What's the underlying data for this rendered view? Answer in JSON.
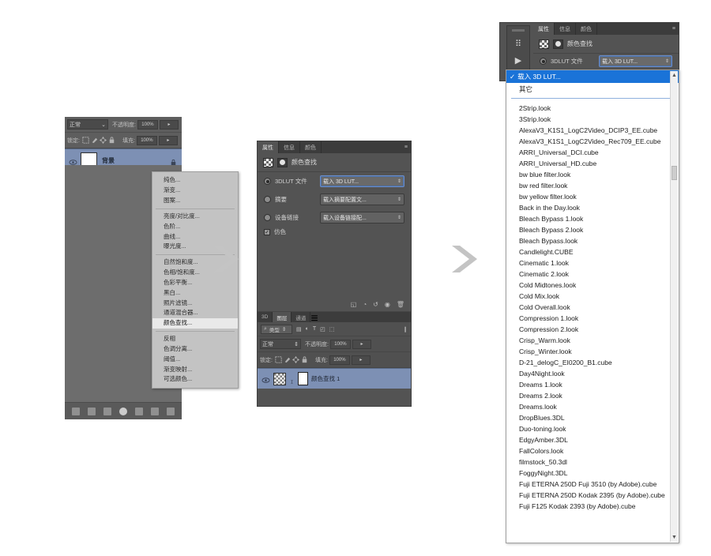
{
  "app": "Adobe Photoshop",
  "steps": {
    "step1": {
      "name": "layers-panel-with-adjustment-menu",
      "blend_mode": "正常",
      "opacity_label": "不透明度:",
      "opacity_value": "100%",
      "lock_label": "锁定:",
      "fill_label": "填充:",
      "fill_value": "100%",
      "layer": {
        "name": "背景",
        "lock_icon": "lock-icon",
        "eye_icon": "eye-icon"
      },
      "bottom_icons": [
        "link-icon",
        "fx-icon",
        "mask-icon",
        "adjustment-icon",
        "group-icon",
        "new-layer-icon",
        "delete-icon"
      ],
      "menu": {
        "groups": [
          [
            "纯色...",
            "渐变...",
            "图案..."
          ],
          [
            "亮度/对比度...",
            "色阶...",
            "曲线...",
            "曝光度..."
          ],
          [
            "自然饱和度...",
            "色相/饱和度...",
            "色彩平衡...",
            "黑白...",
            "照片滤镜...",
            "通道混合器..."
          ],
          [
            "颜色查找..."
          ],
          [
            "反相",
            "色调分离...",
            "阈值...",
            "渐变映射...",
            "可选颜色..."
          ]
        ],
        "selected": "颜色查找..."
      }
    },
    "step2": {
      "name": "color-lookup-properties-panel",
      "tabs": [
        {
          "label": "属性",
          "active": true
        },
        {
          "label": "信息",
          "active": false
        },
        {
          "label": "颜色",
          "active": false
        }
      ],
      "panel_menu_icon": "panel-menu-icon",
      "title": "颜色查找",
      "options": [
        {
          "label": "3DLUT 文件",
          "selected": true,
          "value": "载入 3D LUT...",
          "focused": true
        },
        {
          "label": "摘要",
          "selected": false,
          "value": "载入摘要配置文...",
          "focused": false
        },
        {
          "label": "设备链接",
          "selected": false,
          "value": "载入设备链接配...",
          "focused": false
        }
      ],
      "checkbox": {
        "label": "仿色",
        "checked": true
      },
      "toolbar_icons": [
        "clip-to-layer-icon",
        "view-previous-icon",
        "reset-icon",
        "eye-icon",
        "delete-icon"
      ],
      "layers": {
        "tabs": [
          {
            "label": "3D",
            "active": false
          },
          {
            "label": "图层",
            "active": true
          },
          {
            "label": "通道",
            "active": false
          }
        ],
        "filter_label": "类型",
        "filter_icons": [
          "search-icon",
          "pixel-icon",
          "adjustment-icon",
          "type-icon",
          "shape-icon",
          "smart-icon",
          "lock-filter-icon"
        ],
        "blend_mode": "正常",
        "opacity_label": "不透明度:",
        "opacity_value": "100%",
        "lock_label": "锁定:",
        "fill_label": "填充:",
        "fill_value": "100%",
        "layer_row": {
          "eye_icon": "eye-icon",
          "name": "颜色查找 1"
        }
      }
    },
    "step3": {
      "name": "lut-dropdown-list",
      "tabs": [
        {
          "label": "属性",
          "active": true
        },
        {
          "label": "信息",
          "active": false
        },
        {
          "label": "颜色",
          "active": false
        }
      ],
      "panel_menu_icon": "panel-menu-icon",
      "title": "颜色查找",
      "option_label": "3DLUT 文件",
      "option_value": "载入 3D LUT...",
      "dropdown": {
        "checked_item": "载入 3D LUT...",
        "second_item": "其它",
        "check_icon": "check-icon",
        "files": [
          "2Strip.look",
          "3Strip.look",
          "AlexaV3_K1S1_LogC2Video_DCIP3_EE.cube",
          "AlexaV3_K1S1_LogC2Video_Rec709_EE.cube",
          "ARRI_Universal_DCI.cube",
          "ARRI_Universal_HD.cube",
          "bw blue filter.look",
          "bw red filter.look",
          "bw yellow filter.look",
          "Back in the Day.look",
          "Bleach Bypass 1.look",
          "Bleach Bypass 2.look",
          "Bleach Bypass.look",
          "Candlelight.CUBE",
          "Cinematic 1.look",
          "Cinematic 2.look",
          "Cold Midtones.look",
          "Cold Mix.look",
          "Cold Overall.look",
          "Compression 1.look",
          "Compression 2.look",
          "Crisp_Warm.look",
          "Crisp_Winter.look",
          "D-21_delogC_EI0200_B1.cube",
          "Day4Night.look",
          "Dreams 1.look",
          "Dreams 2.look",
          "Dreams.look",
          "DropBlues.3DL",
          "Duo-toning.look",
          "EdgyAmber.3DL",
          "FallColors.look",
          "filmstock_50.3dl",
          "FoggyNight.3DL",
          "Fuji ETERNA 250D Fuji 3510 (by Adobe).cube",
          "Fuji ETERNA 250D Kodak 2395 (by Adobe).cube",
          "Fuji F125 Kodak 2393 (by Adobe).cube"
        ],
        "scroll_up_icon": "scroll-up-icon",
        "scroll_down_icon": "scroll-down-icon"
      }
    }
  },
  "arrows": {
    "icon": "chevron-right-arrow",
    "color": "#c4c4c4",
    "count": 2
  },
  "colors": {
    "panel_bg": "#535353",
    "selection_blue": "#7d90b4",
    "dropdown_highlight": "#1a73d8",
    "menu_bg": "#c3c3c3",
    "arrow_grey": "#c4c4c4"
  }
}
